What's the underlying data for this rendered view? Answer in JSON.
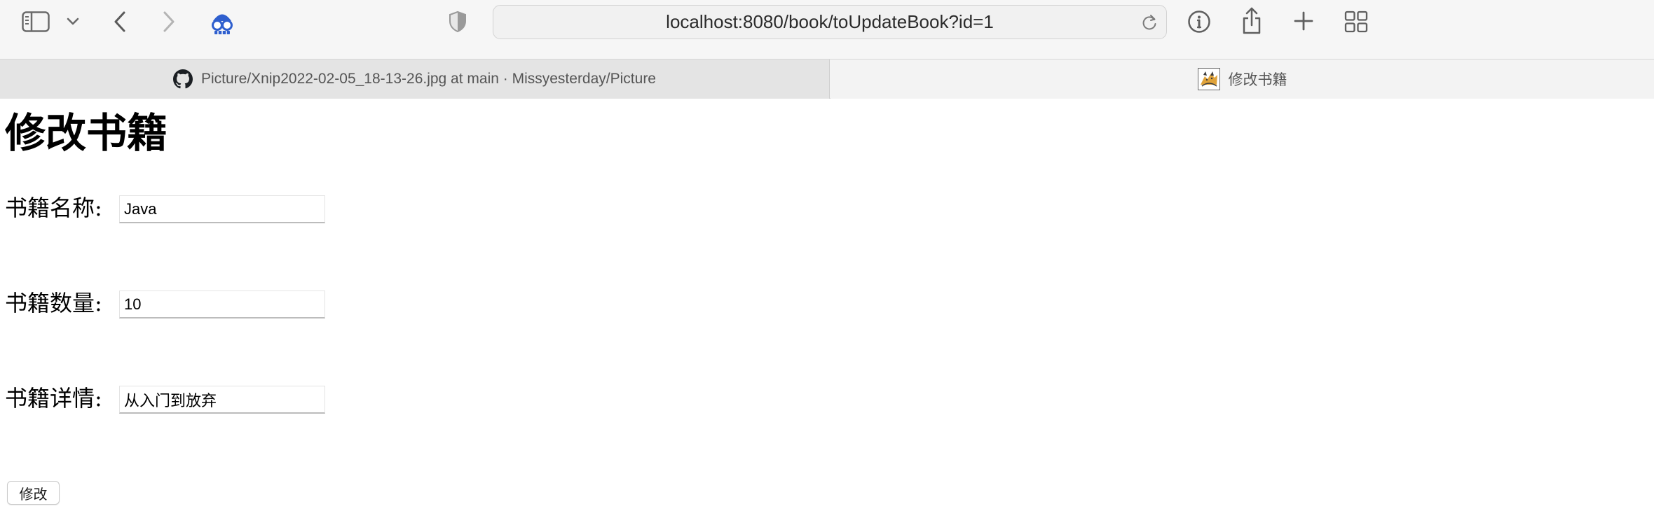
{
  "browser": {
    "address": "localhost:8080/book/toUpdateBook?id=1",
    "tabs": [
      {
        "label": "Picture/Xnip2022-02-05_18-13-26.jpg at main · Missyesterday/Picture",
        "icon": "github-icon",
        "active": false
      },
      {
        "label": "修改书籍",
        "icon": "tomcat-icon",
        "active": true
      }
    ],
    "toolbar_icons": [
      "sidebar-icon",
      "chevron-down-icon",
      "back-icon",
      "forward-icon",
      "extension-icon",
      "privacy-shield-icon",
      "reload-icon",
      "info-icon",
      "share-icon",
      "new-tab-icon",
      "tab-overview-icon"
    ]
  },
  "page": {
    "title": "修改书籍",
    "fields": [
      {
        "label": "书籍名称:",
        "value": "Java"
      },
      {
        "label": "书籍数量:",
        "value": "10"
      },
      {
        "label": "书籍详情:",
        "value": "从入门到放弃"
      }
    ],
    "submit_label": "修改"
  },
  "colors": {
    "toolbar_bg": "#f6f6f6",
    "active_tab_bg": "#f3f3f3",
    "inactive_tab_bg": "#e4e4e4",
    "extension_accent": "#2f5fce"
  }
}
